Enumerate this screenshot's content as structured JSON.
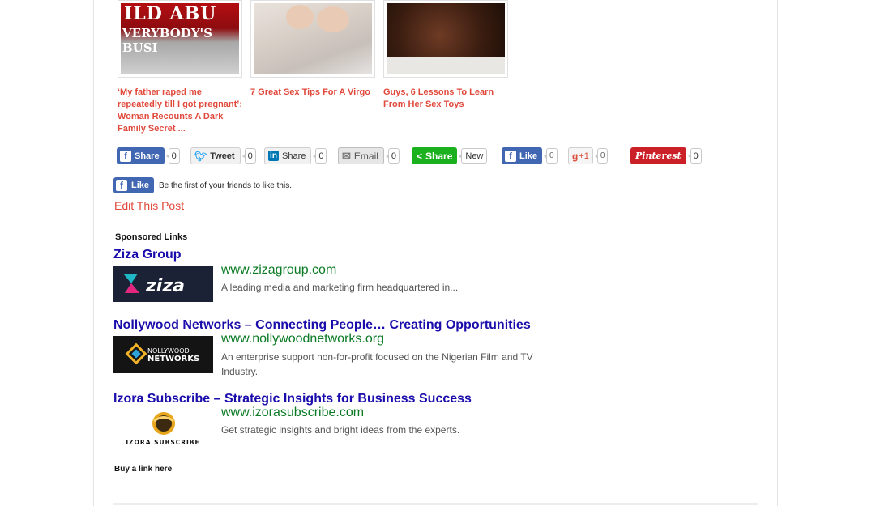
{
  "related_posts": [
    {
      "thumb_text_1": "ILD ABU",
      "thumb_text_2": "VERYBODY'S BUSI",
      "title": "‘My father raped me repeatedly till I got pregnant’: Woman Recounts A Dark Family Secret ..."
    },
    {
      "title": "7 Great Sex Tips For A Virgo"
    },
    {
      "title": "Guys, 6 Lessons To Learn From Her Sex Toys"
    }
  ],
  "share_bar": {
    "facebook": {
      "label": "Share",
      "count": "0"
    },
    "twitter": {
      "label": "Tweet",
      "count": "0"
    },
    "linkedin": {
      "label": "Share",
      "count": "0"
    },
    "email": {
      "label": "Email",
      "count": "0"
    },
    "share": {
      "label": "Share",
      "count": "New"
    },
    "fb_like": {
      "label": "Like",
      "count": "0"
    },
    "gplus": {
      "label": "+1",
      "count": "0"
    },
    "pinterest": {
      "label": "Pinterest",
      "count": "0"
    }
  },
  "facebook_like": {
    "button": "Like",
    "text": "Be the first of your friends to like this."
  },
  "edit_post": "Edit This Post",
  "sponsored_heading": "Sponsored Links",
  "ads": [
    {
      "title": "Ziza Group",
      "url": "www.zizagroup.com",
      "description": "A leading media and marketing firm headquartered in...",
      "logo_text": "ziza"
    },
    {
      "title": "Nollywood Networks – Connecting People… Creating Opportunities",
      "url": "www.nollywoodnetworks.org",
      "description": "An enterprise support non-for-profit focused on the Nigerian Film and TV Industry.",
      "logo_text_1": "NOLLYWOOD",
      "logo_text_2": "NETWORKS"
    },
    {
      "title": "Izora Subscribe – Strategic Insights for Business Success",
      "url": "www.izorasubscribe.com",
      "description": "Get strategic insights and bright ideas from the experts.",
      "logo_text": "IZORA SUBSCRIBE"
    }
  ],
  "buy_link": "Buy a link here",
  "colors": {
    "link_red": "#e0493c",
    "ad_title": "#1a0dab",
    "ad_url": "#0b7a24",
    "facebook": "#4267b2"
  }
}
